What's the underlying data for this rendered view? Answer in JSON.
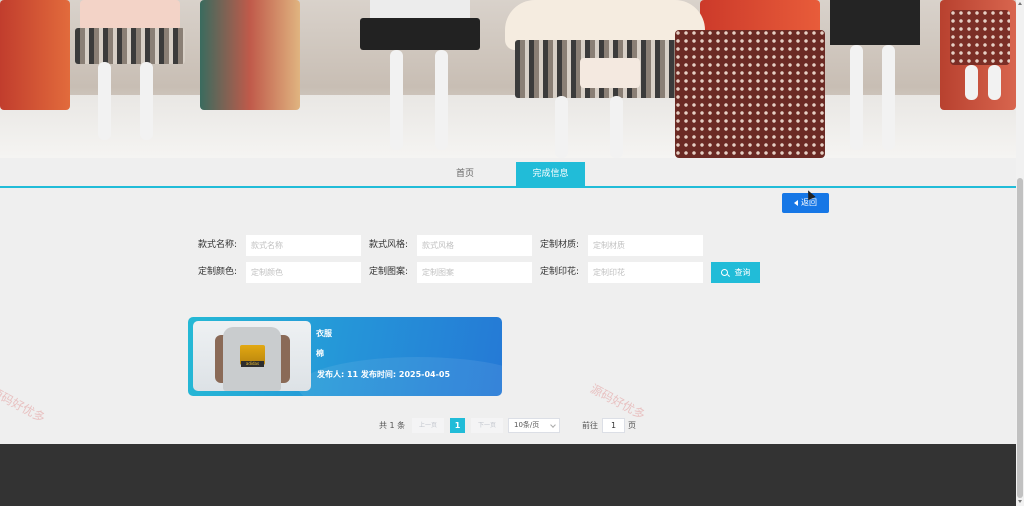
{
  "nav": {
    "tabs": [
      {
        "label": "首页"
      },
      {
        "label": "完成信息"
      }
    ]
  },
  "toolbar": {
    "back_label": "返回"
  },
  "search": {
    "style_name_label": "款式名称:",
    "style_name_placeholder": "款式名称",
    "style_type_label": "款式风格:",
    "style_type_placeholder": "款式风格",
    "material_label": "定制材质:",
    "material_placeholder": "定制材质",
    "color_label": "定制颜色:",
    "color_placeholder": "定制颜色",
    "pattern_label": "定制图案:",
    "pattern_placeholder": "定制图案",
    "print_label": "定制印花:",
    "print_placeholder": "定制印花",
    "search_label": "查询"
  },
  "card": {
    "title": "衣服",
    "material": "棉",
    "publisher_label": "发布人:",
    "publisher": "11",
    "publish_time_label": "发布时间:",
    "publish_time": "2025-04-05",
    "meta": "发布人: 11    发布时间: 2025-04-05",
    "image_logo": "adidas"
  },
  "pagination": {
    "total": "共 1 条",
    "prev": "上一页",
    "current": "1",
    "next": "下一页",
    "page_size": "10条/页",
    "goto_label": "前往",
    "goto_value": "1",
    "page_unit": "页"
  },
  "watermark": {
    "text": "源码好优多"
  },
  "colors": {
    "accent": "#21bcd8",
    "primary_button": "#1677e6",
    "footer": "#333333"
  }
}
